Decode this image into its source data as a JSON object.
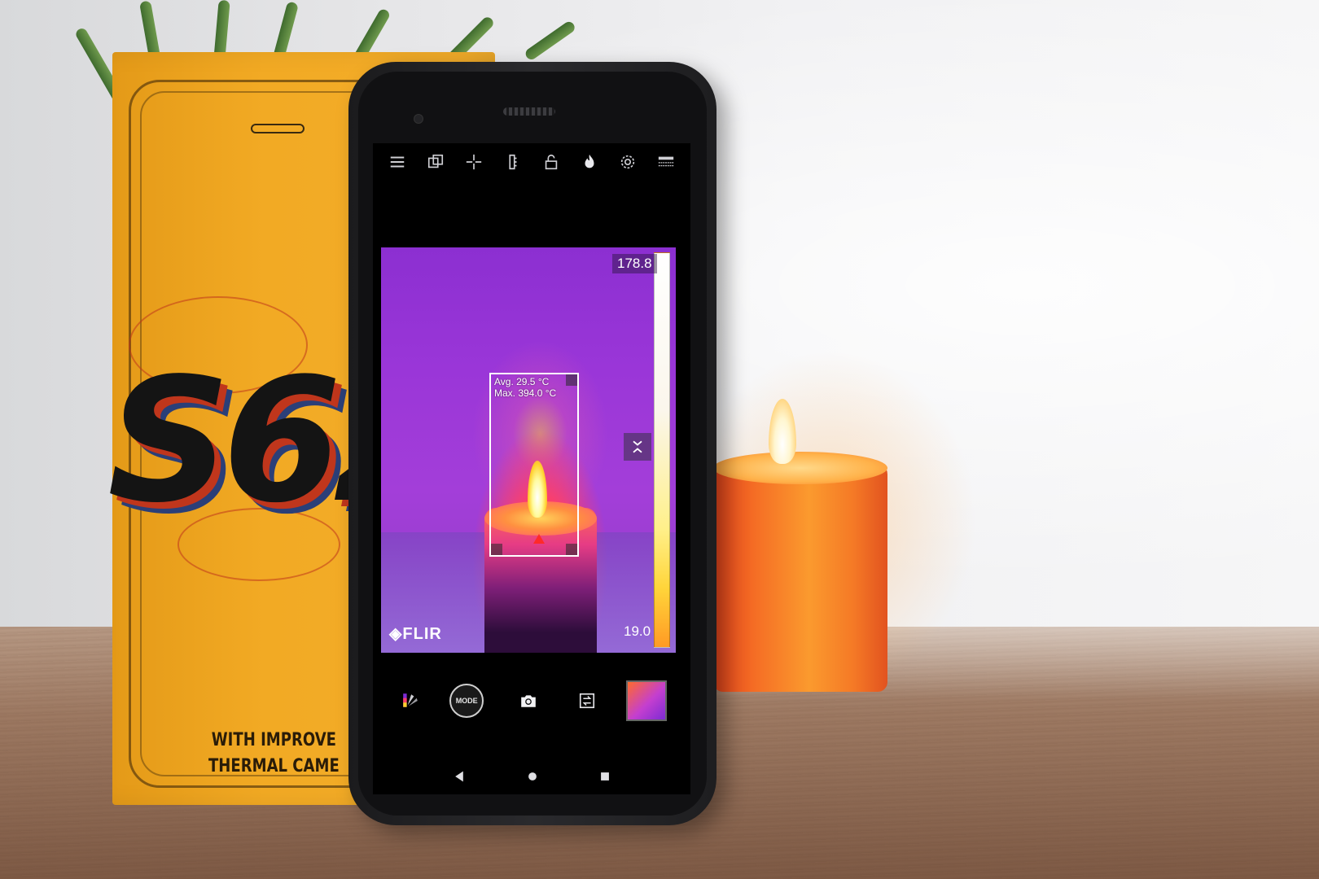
{
  "box": {
    "logo_text": "S62",
    "tagline_line1": "WITH IMPROVE",
    "tagline_line2": "THERMAL CAME"
  },
  "thermal_app": {
    "scale_max": "178.8",
    "scale_min": "19.0",
    "roi_avg": "Avg. 29.5 °C",
    "roi_max": "Max. 394.0 °C",
    "brand": "FLIR",
    "mode_label": "MODE",
    "toolbar_icons": [
      "menu-icon",
      "overlay-icon",
      "spot-meter-icon",
      "scale-icon",
      "lock-icon",
      "flame-icon",
      "settings-icon",
      "palette-strip-icon"
    ],
    "palette": [
      "#8c2fd1",
      "#ff3f66",
      "#ffb01a",
      "#fff35a",
      "#ffffff"
    ]
  },
  "colors": {
    "box_orange": "#f2aa24",
    "candle_orange": "#f56f25",
    "phone_body": "#1b1b1d"
  }
}
